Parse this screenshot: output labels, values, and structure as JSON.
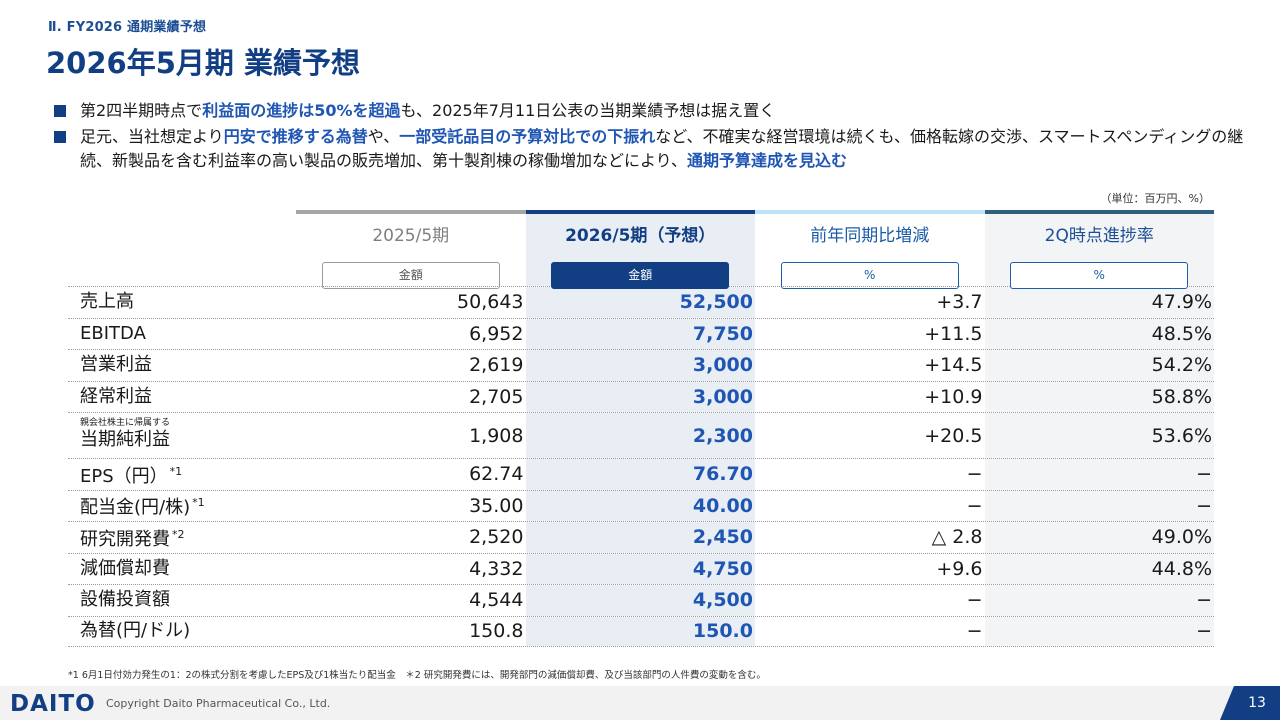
{
  "section_label": "Ⅱ. FY2026 通期業績予想",
  "title": "2026年5月期 業績予想",
  "bullets": [
    {
      "parts": [
        {
          "text": "第2四半期時点で",
          "hl": false
        },
        {
          "text": "利益面の進捗は50%を超過",
          "hl": true
        },
        {
          "text": "も、2025年7月11日公表の当期業績予想は据え置く",
          "hl": false
        }
      ]
    },
    {
      "parts": [
        {
          "text": "足元、当社想定より",
          "hl": false
        },
        {
          "text": "円安で推移する為替",
          "hl": true
        },
        {
          "text": "や、",
          "hl": false
        },
        {
          "text": "一部受託品目の予算対比での下振れ",
          "hl": true
        },
        {
          "text": "など、不確実な経営環境は続くも、価格転嫁の交渉、スマートスペンディングの継続、新製品を含む利益率の高い製品の販売増加、第十製剤棟の稼働増加などにより、",
          "hl": false
        },
        {
          "text": "通期予算達成を見込む",
          "hl": true
        }
      ]
    }
  ],
  "unit_note": "（単位：百万円、%）",
  "table": {
    "columns": [
      {
        "title": "2025/5期",
        "pill": "金額"
      },
      {
        "title": "2026/5期（予想）",
        "pill": "金額"
      },
      {
        "title": "前年同期比増減",
        "pill": "%"
      },
      {
        "title": "2Q時点進捗率",
        "pill": "%"
      }
    ],
    "rows": [
      {
        "label": "売上高",
        "sublabel": "",
        "mark": "",
        "prev": "50,643",
        "fc": "52,500",
        "yoy": "+3.7",
        "prog": "47.9%"
      },
      {
        "label": "EBITDA",
        "sublabel": "",
        "mark": "",
        "prev": "6,952",
        "fc": "7,750",
        "yoy": "+11.5",
        "prog": "48.5%"
      },
      {
        "label": "営業利益",
        "sublabel": "",
        "mark": "",
        "prev": "2,619",
        "fc": "3,000",
        "yoy": "+14.5",
        "prog": "54.2%"
      },
      {
        "label": "経常利益",
        "sublabel": "",
        "mark": "",
        "prev": "2,705",
        "fc": "3,000",
        "yoy": "+10.9",
        "prog": "58.8%"
      },
      {
        "label": "当期純利益",
        "sublabel": "親会社株主に帰属する",
        "mark": "",
        "prev": "1,908",
        "fc": "2,300",
        "yoy": "+20.5",
        "prog": "53.6%"
      },
      {
        "label": "EPS（円）",
        "sublabel": "",
        "mark": "*1",
        "prev": "62.74",
        "fc": "76.70",
        "yoy": "−",
        "prog": "−"
      },
      {
        "label": "配当金(円/株)",
        "sublabel": "",
        "mark": "*1",
        "prev": "35.00",
        "fc": "40.00",
        "yoy": "−",
        "prog": "−"
      },
      {
        "label": "研究開発費",
        "sublabel": "",
        "mark": "*2",
        "prev": "2,520",
        "fc": "2,450",
        "yoy": "△ 2.8",
        "prog": "49.0%"
      },
      {
        "label": "減価償却費",
        "sublabel": "",
        "mark": "",
        "prev": "4,332",
        "fc": "4,750",
        "yoy": "+9.6",
        "prog": "44.8%"
      },
      {
        "label": "設備投資額",
        "sublabel": "",
        "mark": "",
        "prev": "4,544",
        "fc": "4,500",
        "yoy": "−",
        "prog": "−"
      },
      {
        "label": "為替(円/ドル)",
        "sublabel": "",
        "mark": "",
        "prev": "150.8",
        "fc": "150.0",
        "yoy": "−",
        "prog": "−"
      }
    ]
  },
  "footnote": "*1 6月1日付効力発生の1：2の株式分割を考慮したEPS及び1株当たり配当金　＊2 研究開発費には、開発部門の減価償却費、及び当該部門の人件費の変動を含む。",
  "footer": {
    "logo": "DAITO",
    "copyright": "Copyright  Daito Pharmaceutical Co., Ltd.",
    "page_number": "13"
  },
  "colors": {
    "primary": "#123e84",
    "highlight": "#1f56b3",
    "forecast_bg": "#e9eef5"
  }
}
